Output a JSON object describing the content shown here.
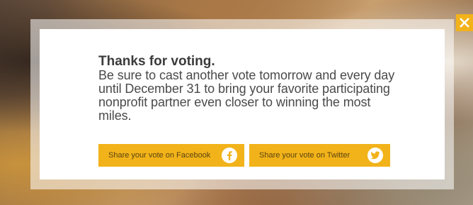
{
  "modal": {
    "title": "Thanks for voting.",
    "message": "Be sure to cast another vote tomorrow and every day until December 31 to bring your favorite participating nonprofit partner even closer to winning the most miles."
  },
  "buttons": {
    "facebook_label": "Share your vote on Facebook",
    "twitter_label": "Share your vote on Twitter"
  },
  "icons": {
    "close": "close-icon",
    "facebook": "facebook-icon",
    "twitter": "twitter-icon"
  },
  "colors": {
    "accent": "#f2b31a",
    "title_text": "#3b3b3b",
    "body_text": "#4a4a4a"
  }
}
